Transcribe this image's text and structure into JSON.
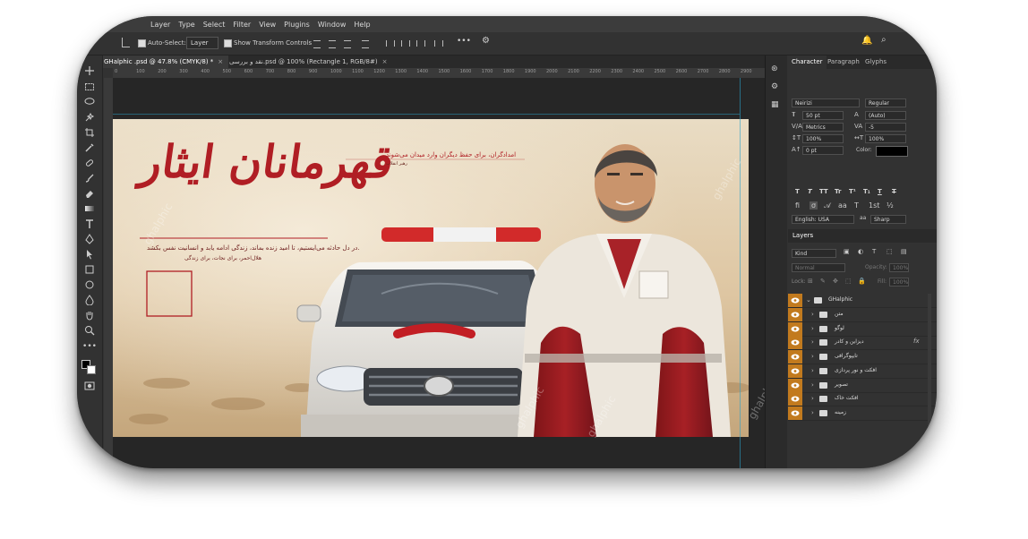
{
  "menu": [
    "Layer",
    "Type",
    "Select",
    "Filter",
    "View",
    "Plugins",
    "Window",
    "Help"
  ],
  "options": {
    "auto_select_label": "Auto-Select:",
    "auto_select_value": "Layer",
    "transform_label": "Show Transform Controls",
    "more_label": "•••"
  },
  "doc_tabs": [
    {
      "label": "GHalphic .psd @ 47.8% (CMYK/8) *"
    },
    {
      "label": "نقد و بررسی.psd @ 100% (Rectangle 1, RGB/8#)"
    }
  ],
  "ruler": [
    "0",
    "100",
    "200",
    "300",
    "400",
    "500",
    "600",
    "700",
    "800",
    "900",
    "1000",
    "1100",
    "1200",
    "1300",
    "1400",
    "1500",
    "1600",
    "1700",
    "1800",
    "1900",
    "2000",
    "2100",
    "2200",
    "2300",
    "2400",
    "2500",
    "2600",
    "2700",
    "2800",
    "2900"
  ],
  "artwork": {
    "title": "قهرمانان ایثار",
    "tagline": "امدادگران، برای حفظ دیگران وارد میدان می‌شوند",
    "credit": "رهبر انقلاب",
    "body": "در دل حادثه می‌ایستیم، تا امید زنده بماند، زندگی ادامه یابد و انسانیت نفس بکشد.",
    "body_sub": "هلال‌احمر، برای نجات، برای زندگی",
    "colors": {
      "red": "#b01e24",
      "sand": "#e3cfae",
      "vest_red": "#9c1e20",
      "white": "#f1ece4"
    }
  },
  "watermark": "ghalphic",
  "character": {
    "tabs": [
      "Character",
      "Paragraph",
      "Glyphs"
    ],
    "font_family": "Neirizi",
    "font_style": "Regular",
    "size": "50 pt",
    "leading": "(Auto)",
    "kerning": "Metrics",
    "tracking": "-5",
    "vscale": "100%",
    "hscale": "100%",
    "baseline": "0 pt",
    "color_label": "Color:",
    "color_value": "#000000",
    "type_buttons": [
      "T",
      "T",
      "TT",
      "Tr",
      "T¹",
      "T₁",
      "T",
      "T"
    ],
    "language": "English: USA",
    "antialias": "Sharp"
  },
  "layers": {
    "title": "Layers",
    "filter": "Kind",
    "blend": "Normal",
    "opacity_label": "Opacity:",
    "opacity": "100%",
    "lock_label": "Lock:",
    "fill_label": "Fill:",
    "fill": "100%",
    "group_name": "GHalphic",
    "items": [
      {
        "name": "متن",
        "fx": ""
      },
      {
        "name": "لوگو",
        "fx": ""
      },
      {
        "name": "دیزاین و کادر",
        "fx": "fx"
      },
      {
        "name": "تایپوگرافی",
        "fx": ""
      },
      {
        "name": "افکت و نور پردازی",
        "fx": ""
      },
      {
        "name": "تصویر",
        "fx": ""
      },
      {
        "name": "افکت خاک",
        "fx": ""
      },
      {
        "name": "زمینه",
        "fx": ""
      }
    ]
  }
}
